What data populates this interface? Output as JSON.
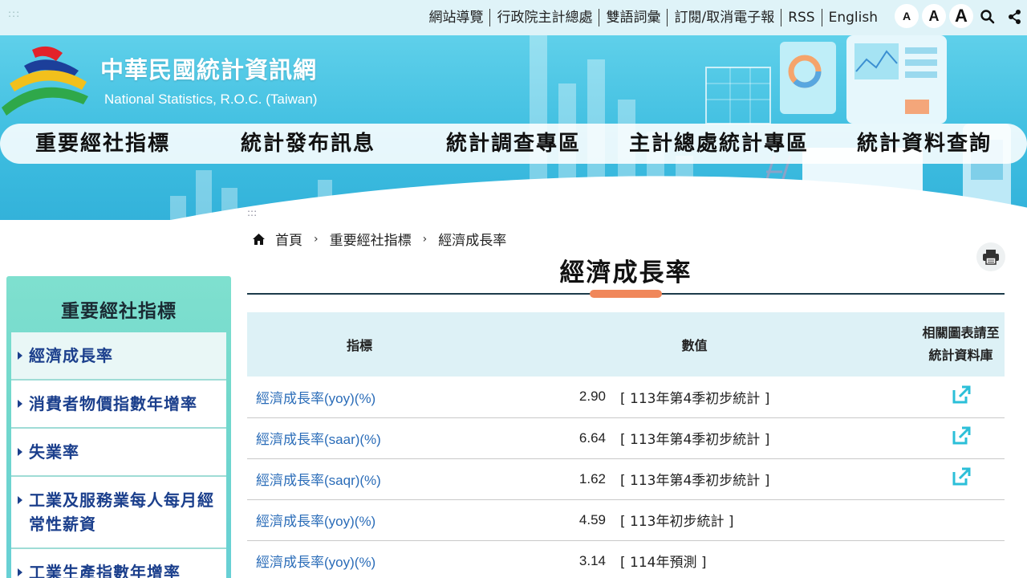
{
  "topbar": {
    "accesskey": ":::",
    "links": [
      "網站導覽",
      "行政院主計總處",
      "雙語詞彙",
      "訂閱/取消電子報",
      "RSS",
      "English"
    ],
    "font_small": "A",
    "font_medium": "A",
    "font_large": "A"
  },
  "site": {
    "title": "中華民國統計資訊網",
    "subtitle": "National Statistics, R.O.C. (Taiwan)"
  },
  "nav": [
    "重要經社指標",
    "統計發布訊息",
    "統計調查專區",
    "主計總處統計專區",
    "統計資料查詢"
  ],
  "breadcrumb": {
    "accesskey": ":::",
    "home": "首頁",
    "level1": "重要經社指標",
    "current": "經濟成長率"
  },
  "page_title": "經濟成長率",
  "sidebar": {
    "title": "重要經社指標",
    "items": [
      "經濟成長率",
      "消費者物價指數年增率",
      "失業率",
      "工業及服務業每人每月經常性薪資",
      "工業生產指數年增率"
    ]
  },
  "table": {
    "headers": {
      "indicator": "指標",
      "value": "數值",
      "link": "相關圖表請至統計資料庫"
    },
    "rows": [
      {
        "indicator": "經濟成長率(yoy)(%)",
        "value": "2.90",
        "note": "[ 113年第4季初步統計 ]",
        "has_link": true
      },
      {
        "indicator": "經濟成長率(saar)(%)",
        "value": "6.64",
        "note": "[ 113年第4季初步統計 ]",
        "has_link": true
      },
      {
        "indicator": "經濟成長率(saqr)(%)",
        "value": "1.62",
        "note": "[ 113年第4季初步統計 ]",
        "has_link": true
      },
      {
        "indicator": "經濟成長率(yoy)(%)",
        "value": "4.59",
        "note": "[ 113年初步統計 ]",
        "has_link": false
      },
      {
        "indicator": "經濟成長率(yoy)(%)",
        "value": "3.14",
        "note": "[ 114年預測 ]",
        "has_link": false
      }
    ]
  },
  "colors": {
    "topbar_bg": "#dff3f8",
    "banner": "#3dbde0",
    "accent": "#f0875a",
    "link": "#2a6cb8",
    "sidebar_link": "#1b3f8c",
    "external_icon": "#2bbfd8"
  },
  "icons": [
    "search-icon",
    "share-icon",
    "home-icon",
    "print-icon",
    "external-link-icon"
  ]
}
